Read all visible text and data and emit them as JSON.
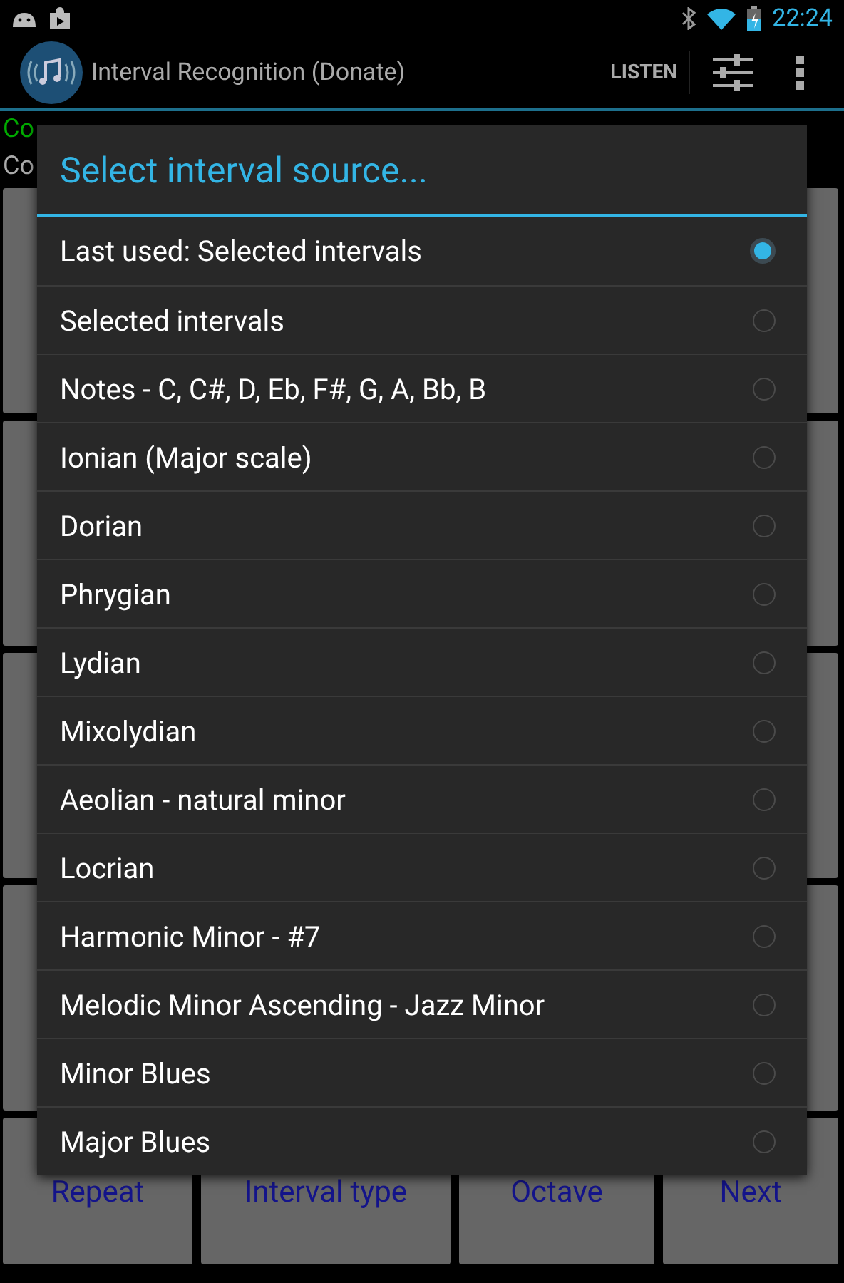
{
  "status_bar": {
    "time": "22:24"
  },
  "action_bar": {
    "title": "Interval Recognition (Donate)",
    "action": "LISTEN"
  },
  "background": {
    "lines": [
      {
        "text": "Co",
        "kind": "correct"
      },
      {
        "text": "Co",
        "kind": "plain"
      }
    ],
    "buttons": [
      "Repeat",
      "Interval type",
      "Octave",
      "Next"
    ]
  },
  "dialog": {
    "title": "Select interval source...",
    "options": [
      {
        "label": "Last used: Selected intervals",
        "selected": true
      },
      {
        "label": "Selected intervals",
        "selected": false
      },
      {
        "label": "Notes - C, C#, D, Eb, F#, G, A, Bb, B",
        "selected": false
      },
      {
        "label": "Ionian (Major scale)",
        "selected": false
      },
      {
        "label": "Dorian",
        "selected": false
      },
      {
        "label": "Phrygian",
        "selected": false
      },
      {
        "label": "Lydian",
        "selected": false
      },
      {
        "label": "Mixolydian",
        "selected": false
      },
      {
        "label": "Aeolian - natural minor",
        "selected": false
      },
      {
        "label": "Locrian",
        "selected": false
      },
      {
        "label": "Harmonic Minor - #7",
        "selected": false
      },
      {
        "label": "Melodic Minor Ascending - Jazz Minor",
        "selected": false
      },
      {
        "label": "Minor Blues",
        "selected": false
      },
      {
        "label": "Major Blues",
        "selected": false
      }
    ]
  }
}
